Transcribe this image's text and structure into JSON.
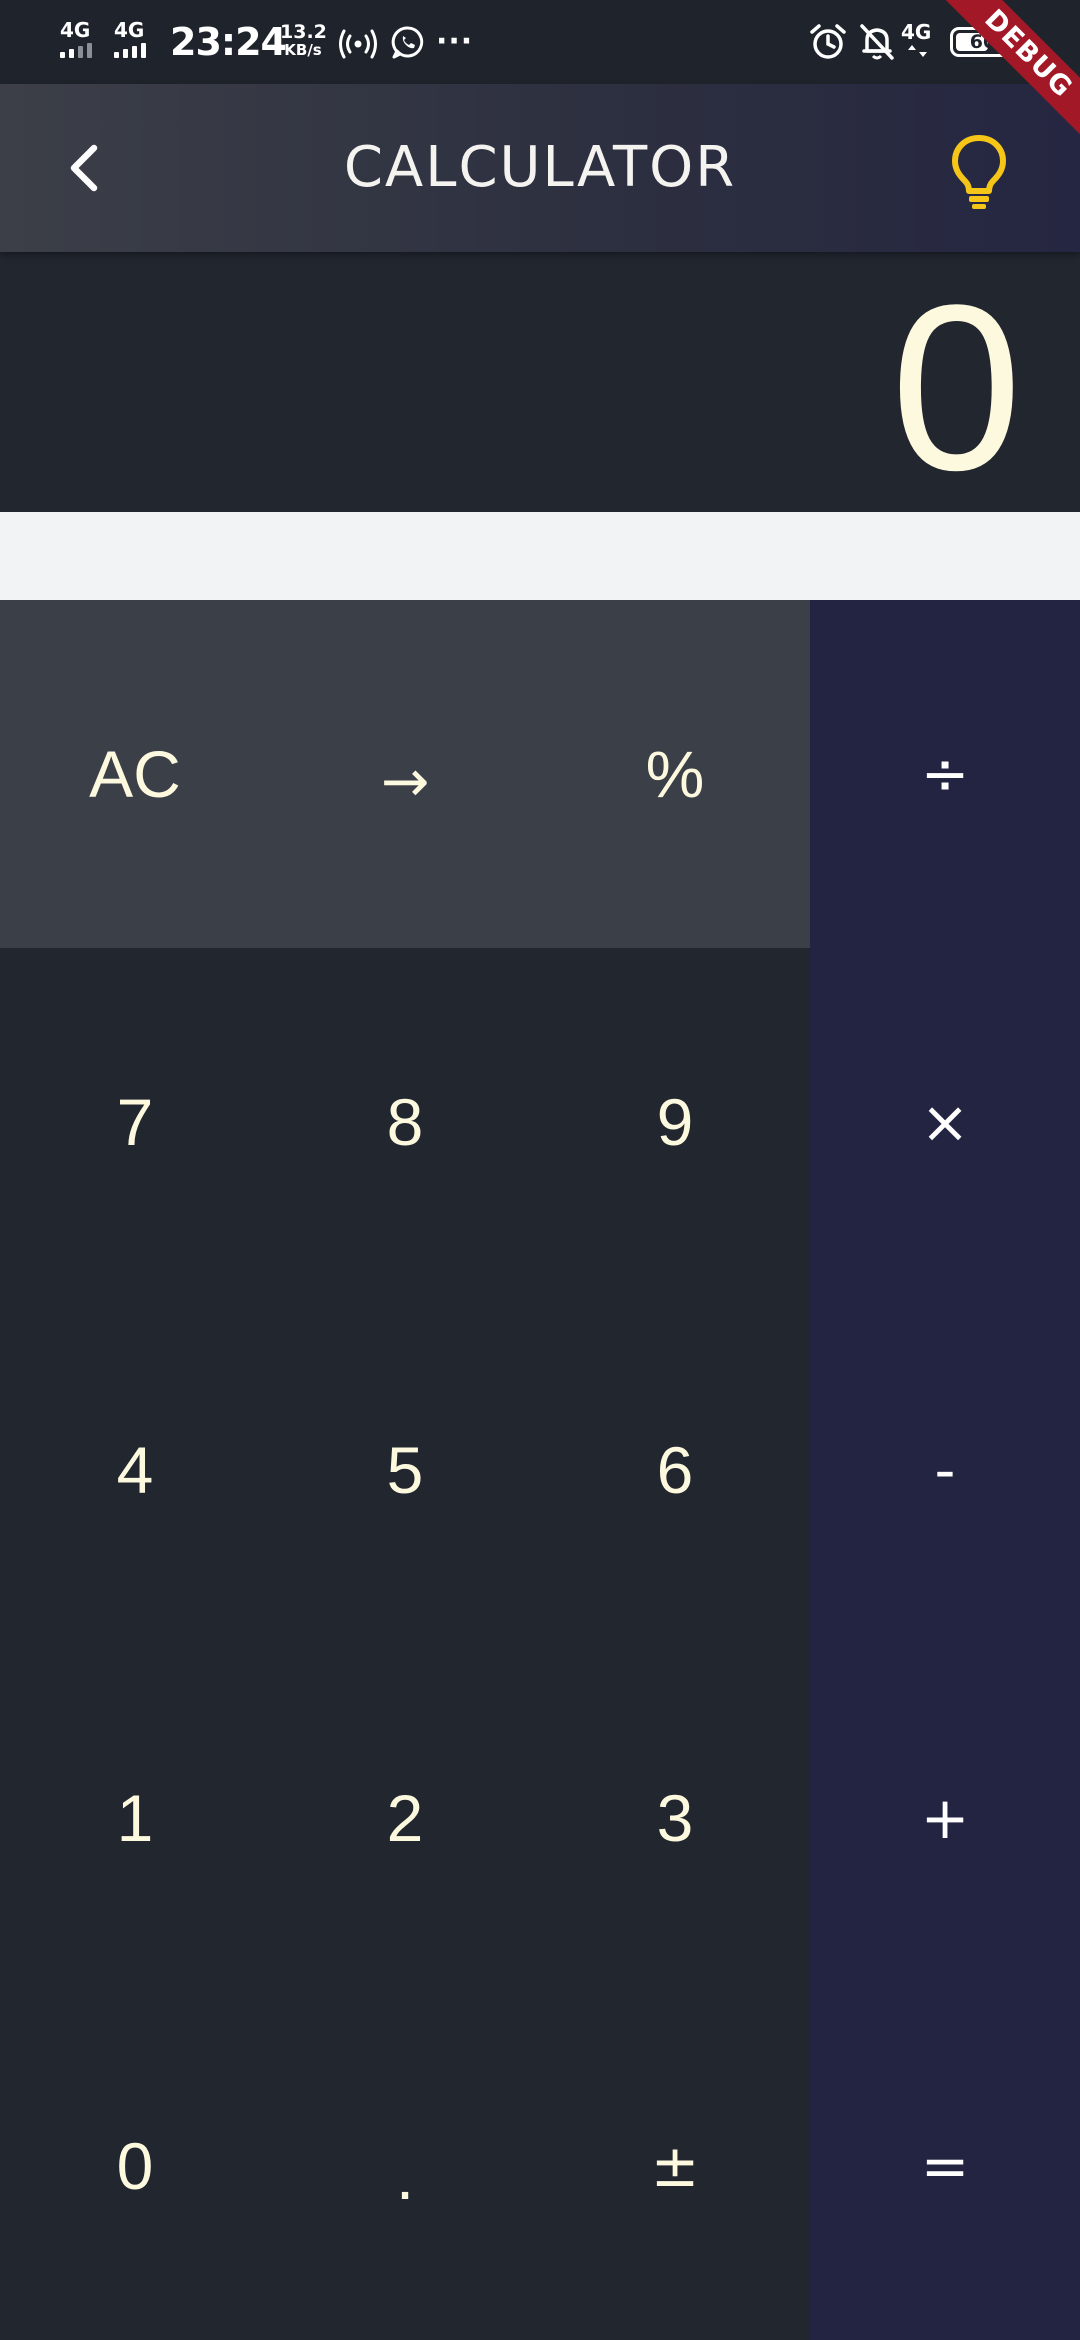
{
  "status_bar": {
    "sim1": {
      "label": "4G"
    },
    "sim2": {
      "label": "4G"
    },
    "time": "23:24",
    "speed_value": "13.2",
    "speed_unit": "KB/s",
    "more": "···",
    "network_right": "4G",
    "battery": "60",
    "battery_level_percent": 60
  },
  "debug_banner": "DEBUG",
  "app_bar": {
    "title": "CALCULATOR",
    "back_icon": "chevron-left-icon",
    "theme_icon": "lightbulb-icon",
    "theme_icon_color": "#f5c518"
  },
  "display": {
    "value": "0"
  },
  "keypad": {
    "row1": [
      "AC",
      "→",
      "%",
      "÷"
    ],
    "row2": [
      "7",
      "8",
      "9",
      "×"
    ],
    "row3": [
      "4",
      "5",
      "6",
      "-"
    ],
    "row4": [
      "1",
      "2",
      "3",
      "+"
    ],
    "row5": [
      "0",
      ".",
      "±",
      "="
    ]
  },
  "colors": {
    "display_text": "#fdf9df",
    "function_row_bg": "#3b3f48",
    "number_bg": "#21262f",
    "operator_col_bg": "#222441",
    "debug_ribbon": "#a31826"
  }
}
